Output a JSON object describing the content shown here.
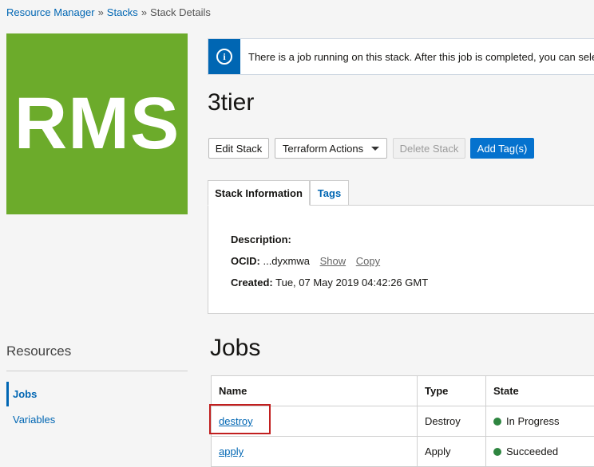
{
  "breadcrumb": {
    "items": [
      "Resource Manager",
      "Stacks",
      "Stack Details"
    ],
    "separator": "»"
  },
  "logo": {
    "text": "RMS",
    "color": "#6cab2b"
  },
  "banner": {
    "icon": "info-icon",
    "message": "There is a job running on this stack. After this job is completed, you can select"
  },
  "stack": {
    "title": "3tier"
  },
  "toolbar": {
    "edit_label": "Edit Stack",
    "terraform_label": "Terraform Actions",
    "delete_label": "Delete Stack",
    "add_tags_label": "Add Tag(s)"
  },
  "tabs": [
    {
      "label": "Stack Information",
      "active": true
    },
    {
      "label": "Tags",
      "active": false
    }
  ],
  "info": {
    "description_label": "Description:",
    "description_value": "",
    "ocid_label": "OCID:",
    "ocid_value": "...dyxmwa",
    "show_label": "Show",
    "copy_label": "Copy",
    "created_label": "Created:",
    "created_value": "Tue, 07 May 2019 04:42:26 GMT"
  },
  "resources": {
    "title": "Resources",
    "items": [
      {
        "label": "Jobs",
        "active": true
      },
      {
        "label": "Variables",
        "active": false
      }
    ]
  },
  "jobs": {
    "title": "Jobs",
    "columns": [
      "Name",
      "Type",
      "State"
    ],
    "rows": [
      {
        "name": "destroy",
        "type": "Destroy",
        "state": "In Progress"
      },
      {
        "name": "apply",
        "type": "Apply",
        "state": "Succeeded"
      }
    ],
    "state_color": "#2e8540"
  },
  "colors": {
    "accent": "#0572ce",
    "link": "#0066b3",
    "highlight": "#c11f1f"
  }
}
